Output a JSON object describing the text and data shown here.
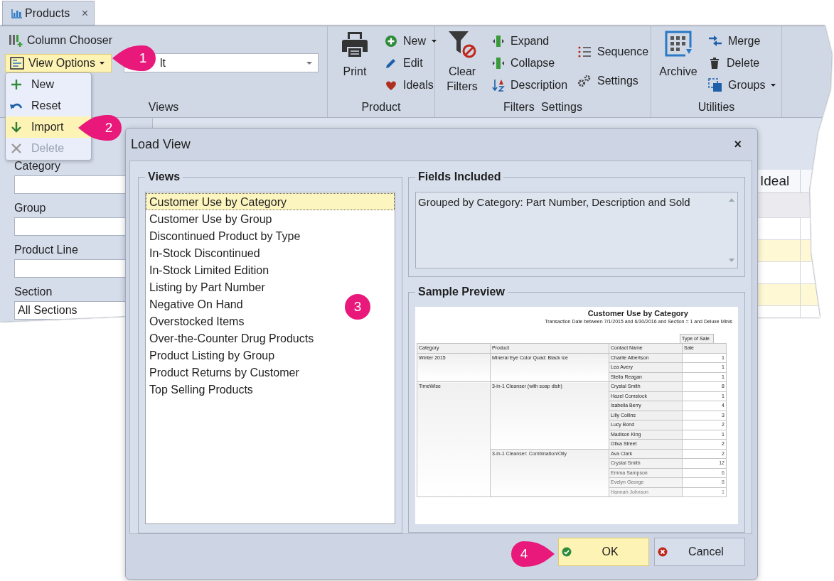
{
  "tab": {
    "title": "Products",
    "close": "×"
  },
  "views_group": {
    "label": "Views",
    "column_chooser": "Column Chooser",
    "view_options": {
      "label": "View Options",
      "pressed": true
    },
    "view_value": "lt"
  },
  "view_menu": [
    {
      "label": "New",
      "selected": false,
      "disabled": false
    },
    {
      "label": "Reset",
      "selected": false,
      "disabled": false
    },
    {
      "label": "Import",
      "selected": true,
      "disabled": false
    },
    {
      "label": "Delete",
      "selected": false,
      "disabled": true
    }
  ],
  "command_groups": [
    {
      "label": "Product",
      "columns": [
        [
          {
            "label": "Print",
            "dropdown": false
          }
        ],
        [
          {
            "label": "New",
            "dropdown": true
          },
          {
            "label": "Edit",
            "dropdown": false
          },
          {
            "label": "Ideals",
            "dropdown": false
          }
        ]
      ]
    },
    {
      "label": "Filters Settings",
      "columns": [
        [
          {
            "label": "Clear Filters",
            "dropdown": false
          }
        ],
        [
          {
            "label": "Expand",
            "dropdown": false
          },
          {
            "label": "Collapse",
            "dropdown": false
          },
          {
            "label": "Description",
            "dropdown": false
          }
        ],
        [
          {
            "label": "Sequence",
            "dropdown": false
          },
          {
            "label": "Settings",
            "dropdown": false
          }
        ]
      ]
    },
    {
      "label": "Utilities",
      "columns": [
        [
          {
            "label": "Archive",
            "dropdown": false
          }
        ],
        [
          {
            "label": "Merge",
            "dropdown": false
          },
          {
            "label": "Delete",
            "dropdown": false
          },
          {
            "label": "Groups",
            "dropdown": true
          }
        ]
      ]
    }
  ],
  "filters": [
    {
      "label": "Category"
    },
    {
      "label": "Group"
    },
    {
      "label": "Product Line"
    },
    {
      "label": "Section",
      "value": "All Sections"
    }
  ],
  "grid": {
    "columns": [
      "Ideal"
    ]
  },
  "dialog": {
    "title": "Load View",
    "close": "×",
    "views": {
      "title": "Views",
      "items": [
        {
          "label": "Customer Use by Category",
          "selected": true
        },
        {
          "label": "Customer Use by Group",
          "selected": false
        },
        {
          "label": "Discontinued Product by Type",
          "selected": false
        },
        {
          "label": "In-Stock Discontinued",
          "selected": false
        },
        {
          "label": "In-Stock Limited Edition",
          "selected": false
        },
        {
          "label": "Listing by Part Number",
          "selected": false
        },
        {
          "label": "Negative On Hand",
          "selected": false
        },
        {
          "label": "Overstocked Items",
          "selected": false
        },
        {
          "label": "Over-the-Counter Drug Products",
          "selected": false
        },
        {
          "label": "Product Listing by Group",
          "selected": false
        },
        {
          "label": "Product Returns by Customer",
          "selected": false
        },
        {
          "label": "Top Selling Products",
          "selected": false
        }
      ]
    },
    "fields_included": {
      "title": "Fields Included",
      "text": "Grouped by Category: Part Number, Description and Sold"
    },
    "sample_preview": {
      "title": "Sample Preview",
      "report": {
        "title": "Customer Use by Category",
        "subtitle": "Transaction Date between 7/1/2015 and 6/30/2016 and Section = 1 and Deluxe Minis",
        "band_header": "Type of Sale",
        "columns": [
          "Category",
          "Product",
          "Contact Name",
          "Sale"
        ],
        "categories": [
          {
            "name": "Winter 2015",
            "products": [
              {
                "name": "Mineral Eye Color Quad: Black Ice",
                "contacts": [
                  {
                    "name": "Charlie Albertson",
                    "sale": "1"
                  },
                  {
                    "name": "Lea Avery",
                    "sale": "1"
                  },
                  {
                    "name": "Stella Reagan",
                    "sale": "1"
                  }
                ]
              }
            ]
          },
          {
            "name": "TimeWise",
            "products": [
              {
                "name": "3-in-1 Cleanser (with soap dish)",
                "contacts": [
                  {
                    "name": "Crystal Smith",
                    "sale": "8"
                  },
                  {
                    "name": "Hazel Comstock",
                    "sale": "1"
                  },
                  {
                    "name": "Isabella Berry",
                    "sale": "4"
                  },
                  {
                    "name": "Lilly Collins",
                    "sale": "3"
                  },
                  {
                    "name": "Lucy Bond",
                    "sale": "2"
                  },
                  {
                    "name": "Madison King",
                    "sale": "1"
                  },
                  {
                    "name": "Oliva Street",
                    "sale": "2"
                  }
                ]
              },
              {
                "name": "3-in-1 Cleanser: Combination/Oily",
                "contacts": [
                  {
                    "name": "Ava Clark",
                    "sale": "2"
                  },
                  {
                    "name": "Crystal Smith",
                    "sale": "12"
                  },
                  {
                    "name": "Emma Sampson",
                    "sale": "6"
                  },
                  {
                    "name": "Evelyn George",
                    "sale": "8"
                  },
                  {
                    "name": "Hannah Johnson",
                    "sale": "1"
                  }
                ]
              }
            ]
          }
        ]
      }
    },
    "buttons": [
      {
        "label": "OK",
        "kind": "ok",
        "focused": true
      },
      {
        "label": "Cancel",
        "kind": "cancel",
        "focused": false
      }
    ]
  },
  "callouts": [
    {
      "number": "1",
      "kind": "left"
    },
    {
      "number": "2",
      "kind": "left"
    },
    {
      "number": "3",
      "kind": "plain"
    },
    {
      "number": "4",
      "kind": "right"
    }
  ]
}
